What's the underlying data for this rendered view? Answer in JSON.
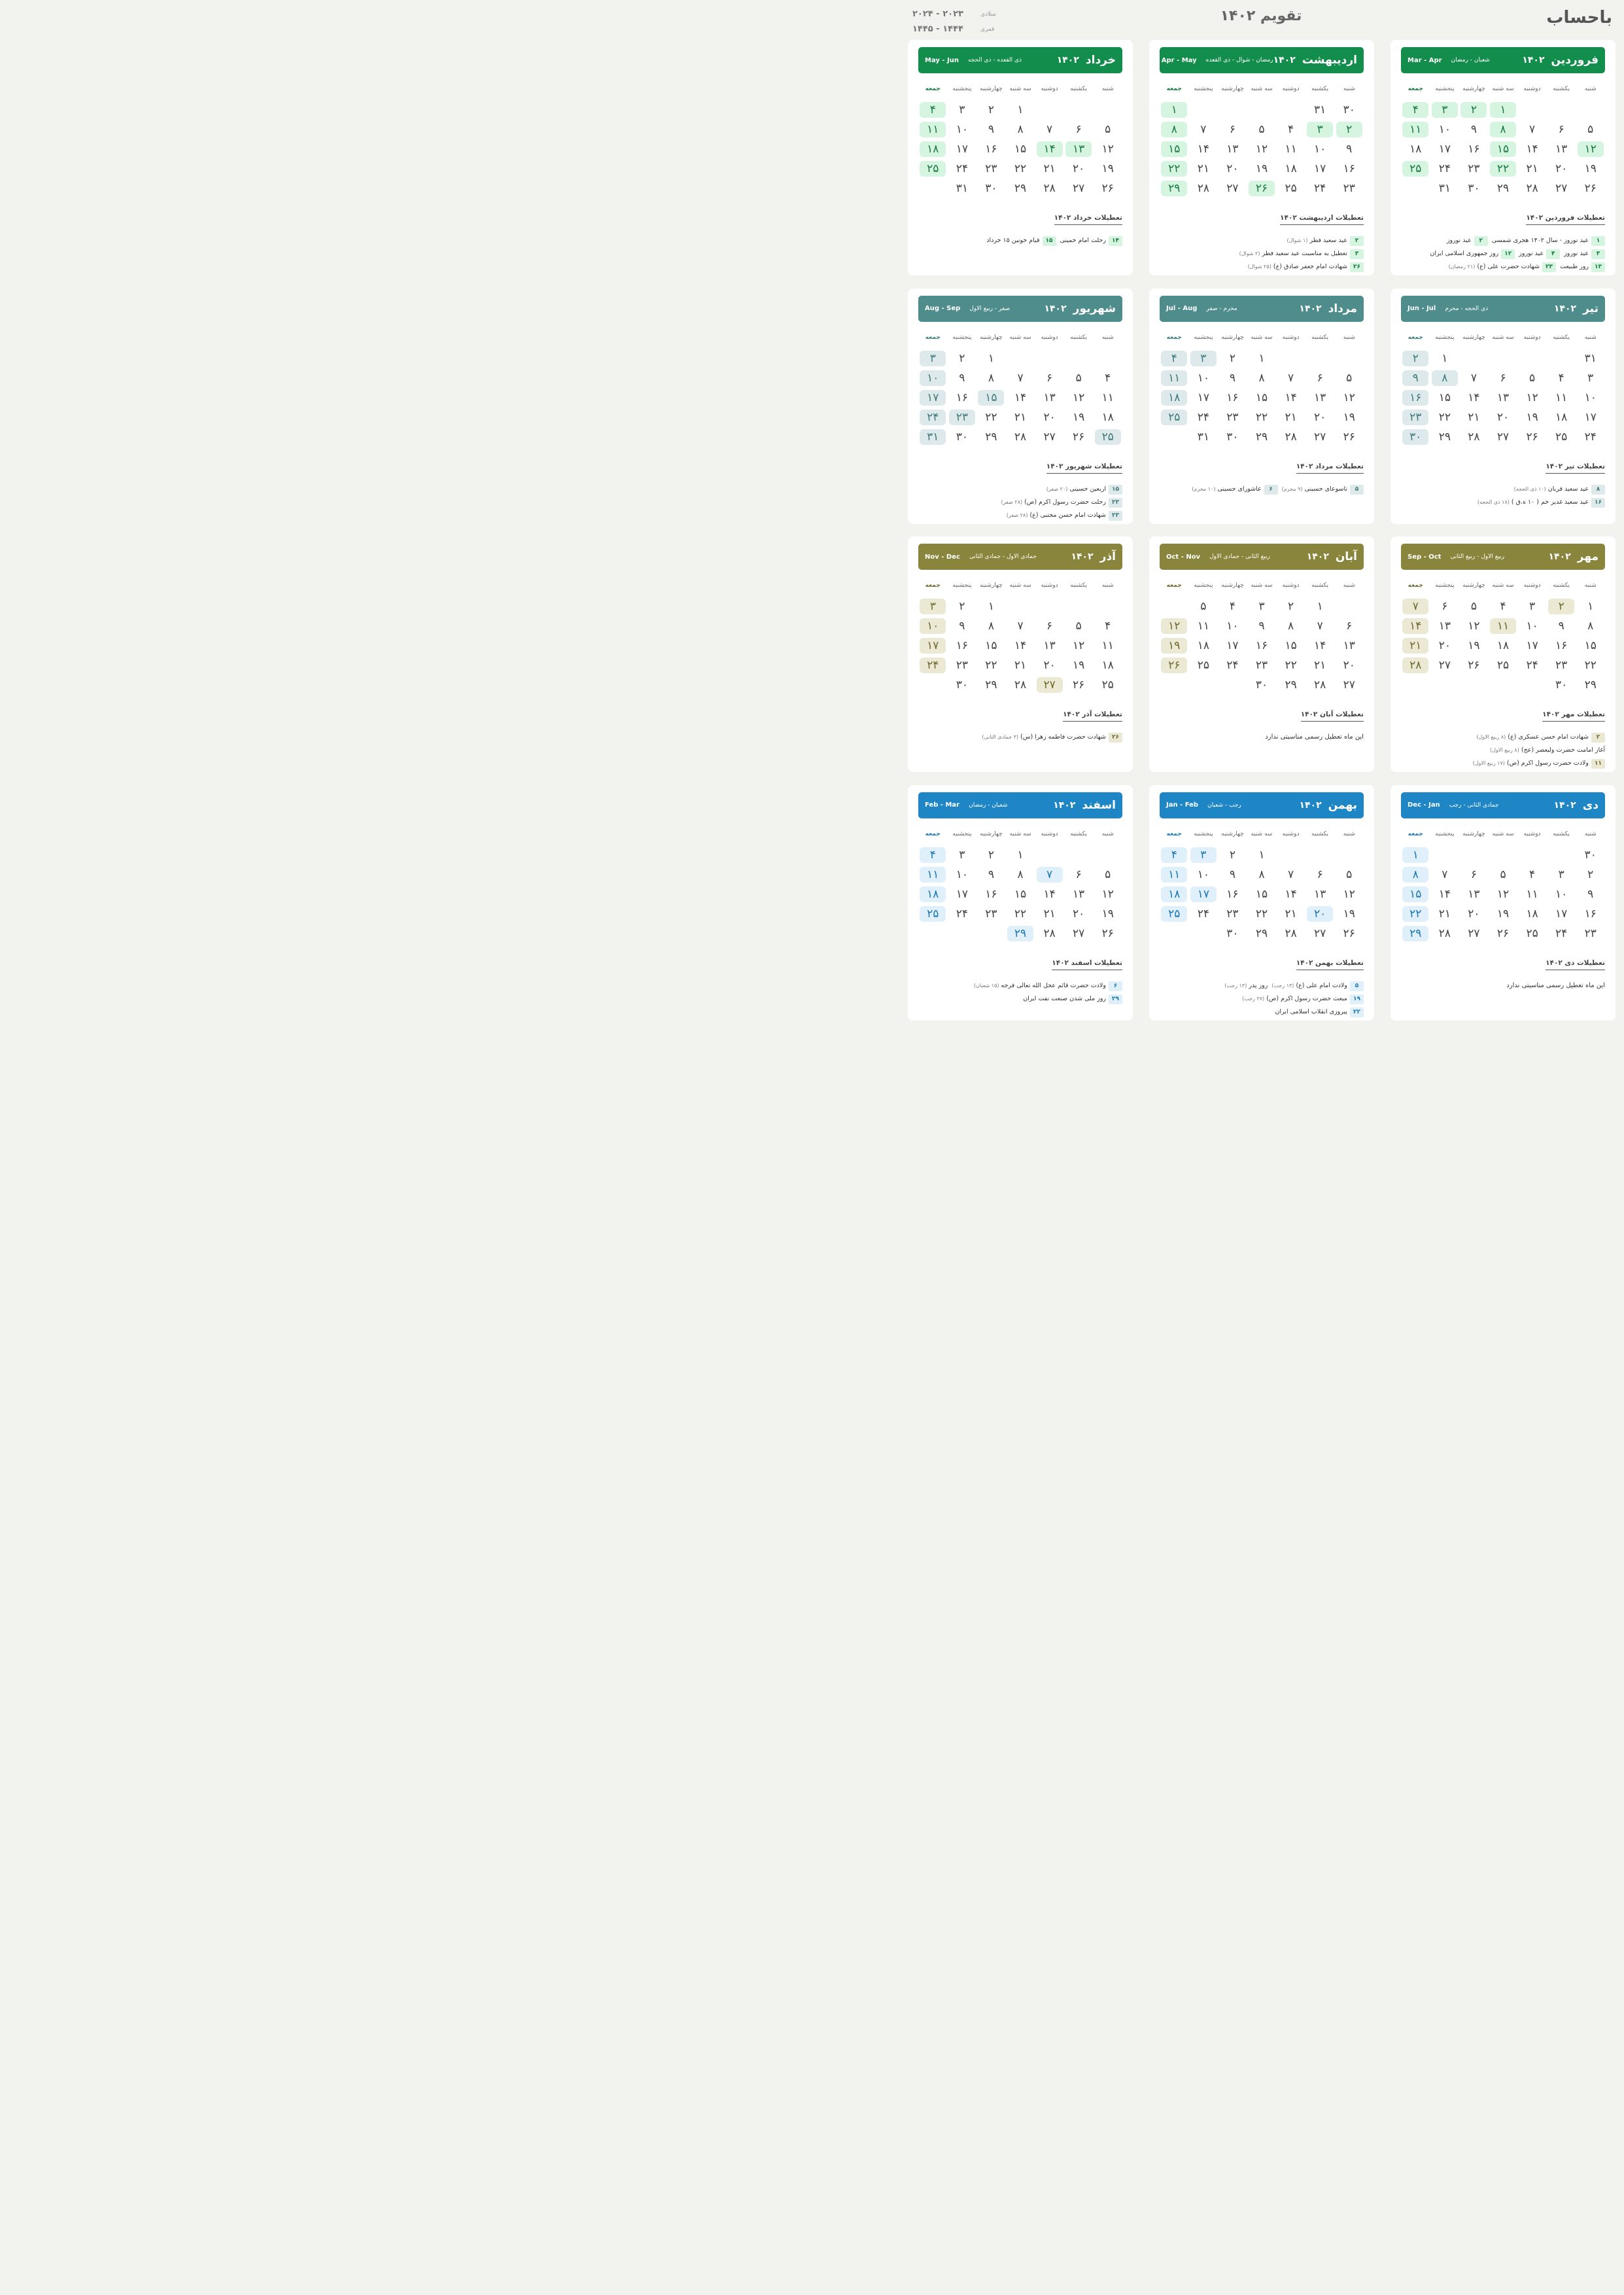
{
  "brand": "باحساب",
  "page_title": "تقویم ۱۴۰۲",
  "years": [
    {
      "label": "میلادی",
      "value": "۲۰۲۳ - ۲۰۲۴"
    },
    {
      "label": "قمری",
      "value": "۱۴۴۴ - ۱۴۴۵"
    }
  ],
  "weekdays": [
    "شنبه",
    "یکشنبه",
    "دوشنبه",
    "سه شنبه",
    "چهارشنبه",
    "پنجشنبه",
    "جمعه"
  ],
  "months": [
    {
      "name": "فروردین",
      "year": "۱۴۰۲",
      "hijri": "شعبان - رمضان",
      "greg": "Mar - Apr",
      "theme": "g",
      "days": [
        "",
        "",
        "",
        "۱",
        "۲",
        "۳",
        "۴",
        "۵",
        "۶",
        "۷",
        "۸",
        "۹",
        "۱۰",
        "۱۱",
        "۱۲",
        "۱۳",
        "۱۴",
        "۱۵",
        "۱۶",
        "۱۷",
        "۱۸",
        "۱۹",
        "۲۰",
        "۲۱",
        "۲۲",
        "۲۳",
        "۲۴",
        "۲۵",
        "۲۶",
        "۲۷",
        "۲۸",
        "۲۹",
        "۳۰",
        "۳۱",
        ""
      ],
      "hl": [
        3,
        4,
        5,
        6,
        10,
        13,
        14,
        17,
        24,
        27
      ],
      "holidays_title": "تعطیلات فروردین ۱۴۰۲",
      "holidays": [
        {
          "day": "۱",
          "text": "عید نوروز - سال ۱۴۰۲ هجری شمسی"
        },
        {
          "day": "۲",
          "text": "عید نوروز"
        },
        {
          "day": "۳",
          "text": "عید نوروز"
        },
        {
          "day": "۴",
          "text": "عید نوروز"
        },
        {
          "day": "۱۲",
          "text": "روز جمهوری اسلامی ایران"
        },
        {
          "day": "۱۳",
          "text": "روز طبیعت"
        },
        {
          "day": "۲۳",
          "text": "شهادت حضرت علی (ع)",
          "sub": "(۲۱ رمضان)"
        }
      ]
    },
    {
      "name": "اردیبهشت",
      "year": "۱۴۰۲",
      "hijri": "رمضان - شوال - ذی القعده",
      "greg": "Apr - May",
      "theme": "g",
      "days": [
        "۳۰",
        "۳۱",
        "",
        "",
        "",
        "",
        "۱",
        "۲",
        "۳",
        "۴",
        "۵",
        "۶",
        "۷",
        "۸",
        "۹",
        "۱۰",
        "۱۱",
        "۱۲",
        "۱۳",
        "۱۴",
        "۱۵",
        "۱۶",
        "۱۷",
        "۱۸",
        "۱۹",
        "۲۰",
        "۲۱",
        "۲۲",
        "۲۳",
        "۲۴",
        "۲۵",
        "۲۶",
        "۲۷",
        "۲۸",
        "۲۹"
      ],
      "hl": [
        6,
        7,
        8,
        13,
        20,
        27,
        31,
        34
      ],
      "holidays_title": "تعطیلات اردیبهشت ۱۴۰۲",
      "holidays": [
        {
          "day": "۲",
          "text": "عید سعید فطر",
          "sub": "(۱ شوال)"
        },
        {
          "day": "۳",
          "text": "تعطیل به مناسبت عید سعید فطر",
          "sub": "(۲ شوال)"
        },
        {
          "day": "۲۶",
          "text": "شهادت امام جعفر صادق (ع)",
          "sub": "(۲۵ شوال)"
        }
      ]
    },
    {
      "name": "خرداد",
      "year": "۱۴۰۲",
      "hijri": "ذی القعده - ذی الحجه",
      "greg": "May - Jun",
      "theme": "g",
      "days": [
        "",
        "",
        "",
        "۱",
        "۲",
        "۳",
        "۴",
        "۵",
        "۶",
        "۷",
        "۸",
        "۹",
        "۱۰",
        "۱۱",
        "۱۲",
        "۱۳",
        "۱۴",
        "۱۵",
        "۱۶",
        "۱۷",
        "۱۸",
        "۱۹",
        "۲۰",
        "۲۱",
        "۲۲",
        "۲۳",
        "۲۴",
        "۲۵",
        "۲۶",
        "۲۷",
        "۲۸",
        "۲۹",
        "۳۰",
        "۳۱",
        ""
      ],
      "hl": [
        6,
        13,
        15,
        16,
        20,
        27
      ],
      "holidays_title": "تعطیلات خرداد ۱۴۰۲",
      "holidays": [
        {
          "day": "۱۴",
          "text": "رحلت امام خمینی"
        },
        {
          "day": "۱۵",
          "text": "قیام خونین ۱۵ خرداد"
        }
      ]
    },
    {
      "name": "تیر",
      "year": "۱۴۰۲",
      "hijri": "ذی الحجه - محرم",
      "greg": "Jun - Jul",
      "theme": "t",
      "days": [
        "۳۱",
        "",
        "",
        "",
        "",
        "۱",
        "۲",
        "۳",
        "۴",
        "۵",
        "۶",
        "۷",
        "۸",
        "۹",
        "۱۰",
        "۱۱",
        "۱۲",
        "۱۳",
        "۱۴",
        "۱۵",
        "۱۶",
        "۱۷",
        "۱۸",
        "۱۹",
        "۲۰",
        "۲۱",
        "۲۲",
        "۲۳",
        "۲۴",
        "۲۵",
        "۲۶",
        "۲۷",
        "۲۸",
        "۲۹",
        "۳۰"
      ],
      "hl": [
        6,
        12,
        13,
        20,
        27,
        34
      ],
      "holidays_title": "تعطیلات تیر ۱۴۰۲",
      "holidays": [
        {
          "day": "۸",
          "text": "عید سعید قربان",
          "sub": "(۱۰ ذی الحجه)"
        },
        {
          "day": "۱۶",
          "text": "عید سعید غدیر خم ( ۱۰ ه.ق )",
          "sub": "(۱۸ ذی الحجه)"
        }
      ]
    },
    {
      "name": "مرداد",
      "year": "۱۴۰۲",
      "hijri": "محرم - صفر",
      "greg": "Jul - Aug",
      "theme": "t",
      "days": [
        "",
        "",
        "",
        "۱",
        "۲",
        "۳",
        "۴",
        "۵",
        "۶",
        "۷",
        "۸",
        "۹",
        "۱۰",
        "۱۱",
        "۱۲",
        "۱۳",
        "۱۴",
        "۱۵",
        "۱۶",
        "۱۷",
        "۱۸",
        "۱۹",
        "۲۰",
        "۲۱",
        "۲۲",
        "۲۳",
        "۲۴",
        "۲۵",
        "۲۶",
        "۲۷",
        "۲۸",
        "۲۹",
        "۳۰",
        "۳۱",
        ""
      ],
      "hl": [
        5,
        6,
        13,
        20,
        27
      ],
      "holidays_title": "تعطیلات مرداد ۱۴۰۲",
      "holidays": [
        {
          "day": "۵",
          "text": "تاسوعای حسینی",
          "sub": "(۹ محرم)"
        },
        {
          "day": "۶",
          "text": "عاشورای حسینی",
          "sub": "(۱۰ محرم)"
        }
      ]
    },
    {
      "name": "شهریور",
      "year": "۱۴۰۲",
      "hijri": "صفر - ربیع الاول",
      "greg": "Aug - Sep",
      "theme": "t",
      "days": [
        "",
        "",
        "",
        "",
        "۱",
        "۲",
        "۳",
        "۴",
        "۵",
        "۶",
        "۷",
        "۸",
        "۹",
        "۱۰",
        "۱۱",
        "۱۲",
        "۱۳",
        "۱۴",
        "۱۵",
        "۱۶",
        "۱۷",
        "۱۸",
        "۱۹",
        "۲۰",
        "۲۱",
        "۲۲",
        "۲۳",
        "۲۴",
        "۲۵",
        "۲۶",
        "۲۷",
        "۲۸",
        "۲۹",
        "۳۰",
        "۳۱"
      ],
      "hl": [
        6,
        13,
        18,
        20,
        26,
        27,
        28,
        34
      ],
      "holidays_title": "تعطیلات شهریور ۱۴۰۲",
      "holidays": [
        {
          "day": "۱۵",
          "text": "اربعین حسینی",
          "sub": "(۲۰ صفر)"
        },
        {
          "day": "۲۳",
          "text": "رحلت حضرت رسول اکرم (ص)",
          "sub": "(۲۸ صفر)"
        },
        {
          "day": "۲۳",
          "text": "شهادت امام حسن مجتبی (ع)",
          "sub": "(۲۸ صفر)"
        },
        {
          "day": "۲۵",
          "text": "شهادت امام رضا (ع)",
          "sub": "(۳۰ صفر)"
        }
      ]
    },
    {
      "name": "مهر",
      "year": "۱۴۰۲",
      "hijri": "ربیع الاول - ربیع الثانی",
      "greg": "Sep - Oct",
      "theme": "o",
      "days": [
        "۱",
        "۲",
        "۳",
        "۴",
        "۵",
        "۶",
        "۷",
        "۸",
        "۹",
        "۱۰",
        "۱۱",
        "۱۲",
        "۱۳",
        "۱۴",
        "۱۵",
        "۱۶",
        "۱۷",
        "۱۸",
        "۱۹",
        "۲۰",
        "۲۱",
        "۲۲",
        "۲۳",
        "۲۴",
        "۲۵",
        "۲۶",
        "۲۷",
        "۲۸",
        "۲۹",
        "۳۰",
        "",
        "",
        "",
        "",
        ""
      ],
      "hl": [
        1,
        6,
        10,
        13,
        20,
        27
      ],
      "holidays_title": "تعطیلات مهر ۱۴۰۲",
      "holidays": [
        {
          "day": "۲",
          "text": "شهادت امام حسن عسکری (ع)",
          "sub": "(۸ ربیع الاول)"
        },
        {
          "day": "",
          "text": "آغاز امامت حضرت ولیعصر (عج)",
          "sub": "(۸ ربیع الاول)"
        },
        {
          "day": "۱۱",
          "text": "ولادت حضرت رسول اکرم (ص)",
          "sub": "(۱۷ ربیع الاول)"
        },
        {
          "day": "",
          "text": "ولادت امام جعفر صادق (ع)",
          "sub": "(۱۷ ربیع الاول)"
        }
      ]
    },
    {
      "name": "آبان",
      "year": "۱۴۰۲",
      "hijri": "ربیع الثانی - جمادی الاول",
      "greg": "Oct - Nov",
      "theme": "o",
      "days": [
        "",
        "۱",
        "۲",
        "۳",
        "۴",
        "۵",
        "",
        "۶",
        "۷",
        "۸",
        "۹",
        "۱۰",
        "۱۱",
        "۱۲",
        "۱۳",
        "۱۴",
        "۱۵",
        "۱۶",
        "۱۷",
        "۱۸",
        "۱۹",
        "۲۰",
        "۲۱",
        "۲۲",
        "۲۳",
        "۲۴",
        "۲۵",
        "۲۶",
        "۲۷",
        "۲۸",
        "۲۹",
        "۳۰",
        "",
        "",
        ""
      ],
      "hl": [
        6,
        13,
        20,
        27
      ],
      "holidays_title": "تعطیلات آبان ۱۴۰۲",
      "none": "این ماه تعطیل رسمی مناسبتی ندارد"
    },
    {
      "name": "آذر",
      "year": "۱۴۰۲",
      "hijri": "جمادی الاول - جمادی الثانی",
      "greg": "Nov - Dec",
      "theme": "o",
      "days": [
        "",
        "",
        "",
        "",
        "۱",
        "۲",
        "۳",
        "۴",
        "۵",
        "۶",
        "۷",
        "۸",
        "۹",
        "۱۰",
        "۱۱",
        "۱۲",
        "۱۳",
        "۱۴",
        "۱۵",
        "۱۶",
        "۱۷",
        "۱۸",
        "۱۹",
        "۲۰",
        "۲۱",
        "۲۲",
        "۲۳",
        "۲۴",
        "۲۵",
        "۲۶",
        "۲۷",
        "۲۸",
        "۲۹",
        "۳۰",
        ""
      ],
      "hl": [
        6,
        13,
        20,
        27,
        30
      ],
      "holidays_title": "تعطیلات آذر ۱۴۰۲",
      "holidays": [
        {
          "day": "۲۶",
          "text": "شهادت حضرت فاطمه زهرا (س)",
          "sub": "(۳ جمادی الثانی)"
        }
      ]
    },
    {
      "name": "دی",
      "year": "۱۴۰۲",
      "hijri": "جمادی الثانی - رجب",
      "greg": "Dec - Jan",
      "theme": "b",
      "days": [
        "۳۰",
        "",
        "",
        "",
        "",
        "",
        "۱",
        "۲",
        "۳",
        "۴",
        "۵",
        "۶",
        "۷",
        "۸",
        "۹",
        "۱۰",
        "۱۱",
        "۱۲",
        "۱۳",
        "۱۴",
        "۱۵",
        "۱۶",
        "۱۷",
        "۱۸",
        "۱۹",
        "۲۰",
        "۲۱",
        "۲۲",
        "۲۳",
        "۲۴",
        "۲۵",
        "۲۶",
        "۲۷",
        "۲۸",
        "۲۹"
      ],
      "hl": [
        6,
        13,
        20,
        27,
        34
      ],
      "holidays_title": "تعطیلات دی ۱۴۰۲",
      "none": "این ماه تعطیل رسمی مناسبتی ندارد"
    },
    {
      "name": "بهمن",
      "year": "۱۴۰۲",
      "hijri": "رجب - شعبان",
      "greg": "Jan - Feb",
      "theme": "b",
      "days": [
        "",
        "",
        "",
        "۱",
        "۲",
        "۳",
        "۴",
        "۵",
        "۶",
        "۷",
        "۸",
        "۹",
        "۱۰",
        "۱۱",
        "۱۲",
        "۱۳",
        "۱۴",
        "۱۵",
        "۱۶",
        "۱۷",
        "۱۸",
        "۱۹",
        "۲۰",
        "۲۱",
        "۲۲",
        "۲۳",
        "۲۴",
        "۲۵",
        "۲۶",
        "۲۷",
        "۲۸",
        "۲۹",
        "۳۰",
        "",
        ""
      ],
      "hl": [
        5,
        6,
        13,
        19,
        20,
        22,
        27
      ],
      "holidays_title": "تعطیلات بهمن ۱۴۰۲",
      "holidays": [
        {
          "day": "۵",
          "text": "ولادت امام علی (ع)",
          "sub": "(۱۳ رجب)"
        },
        {
          "day": "",
          "text": "روز پدر",
          "sub": "(۱۳ رجب)"
        },
        {
          "day": "۱۹",
          "text": "مبعث حضرت رسول اکرم (ص)",
          "sub": "(۲۷ رجب)"
        },
        {
          "day": "۲۲",
          "text": "پیروزی انقلاب اسلامی ایران"
        }
      ]
    },
    {
      "name": "اسفند",
      "year": "۱۴۰۲",
      "hijri": "شعبان - رمضان",
      "greg": "Feb - Mar",
      "theme": "b",
      "days": [
        "",
        "",
        "",
        "۱",
        "۲",
        "۳",
        "۴",
        "۵",
        "۶",
        "۷",
        "۸",
        "۹",
        "۱۰",
        "۱۱",
        "۱۲",
        "۱۳",
        "۱۴",
        "۱۵",
        "۱۶",
        "۱۷",
        "۱۸",
        "۱۹",
        "۲۰",
        "۲۱",
        "۲۲",
        "۲۳",
        "۲۴",
        "۲۵",
        "۲۶",
        "۲۷",
        "۲۸",
        "۲۹",
        "",
        "",
        ""
      ],
      "hl": [
        6,
        9,
        13,
        20,
        27,
        31
      ],
      "holidays_title": "تعطیلات اسفند ۱۴۰۲",
      "holidays": [
        {
          "day": "۶",
          "text": "ولادت حضرت قائم عجل الله تعالی فرجه",
          "sub": "(۱۵ شعبان)"
        },
        {
          "day": "۲۹",
          "text": "روز ملی شدن صنعت نفت ایران"
        }
      ]
    }
  ]
}
